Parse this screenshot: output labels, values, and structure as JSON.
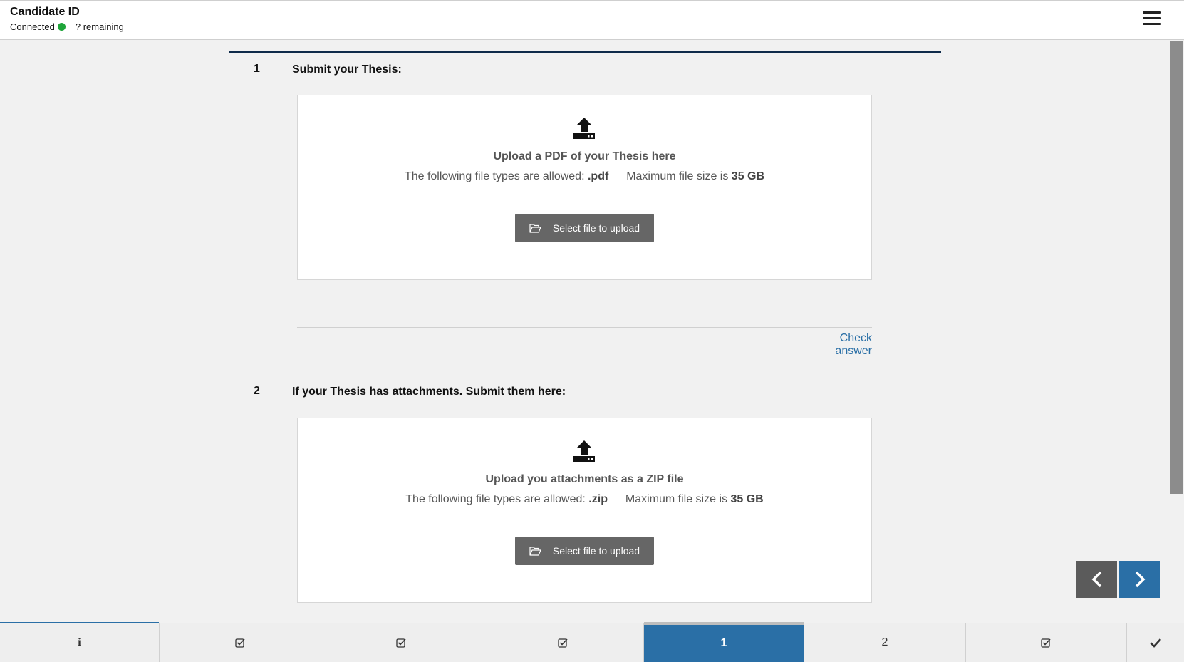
{
  "header": {
    "title": "Candidate ID",
    "status_label": "Connected",
    "status_color": "#1fa53a",
    "remaining": "? remaining",
    "menu_icon": "hamburger-menu-icon"
  },
  "questions": [
    {
      "number": "1",
      "title": "Submit your Thesis:",
      "upload_title": "Upload a PDF of your Thesis here",
      "allowed_label": "The following file types are allowed:",
      "allowed_types": ".pdf",
      "max_label": "Maximum file size is",
      "max_size": "35 GB",
      "button_label": "Select file to upload"
    },
    {
      "number": "2",
      "title": "If your Thesis has attachments. Submit them here:",
      "upload_title": "Upload you attachments as a ZIP file",
      "allowed_label": "The following file types are allowed:",
      "allowed_types": ".zip",
      "max_label": "Maximum file size is",
      "max_size": "35 GB",
      "button_label": "Select file to upload"
    }
  ],
  "check_answer": "Check answer",
  "navigation": {
    "prev_icon": "chevron-left-icon",
    "next_icon": "chevron-right-icon"
  },
  "bottom_tabs": [
    {
      "label": "i",
      "icon": "info-icon",
      "state": "visited"
    },
    {
      "label": "",
      "icon": "checkbox-checked-icon",
      "state": "answered"
    },
    {
      "label": "",
      "icon": "checkbox-checked-icon",
      "state": "answered"
    },
    {
      "label": "",
      "icon": "checkbox-checked-icon",
      "state": "answered"
    },
    {
      "label": "1",
      "icon": "",
      "state": "active"
    },
    {
      "label": "2",
      "icon": "",
      "state": "unanswered"
    },
    {
      "label": "",
      "icon": "checkbox-checked-icon",
      "state": "answered"
    },
    {
      "label": "",
      "icon": "checkmark-icon",
      "state": "finish"
    }
  ],
  "colors": {
    "accent": "#2a6fa6",
    "header_rule": "#0f2b4a",
    "button_gray": "#666666"
  }
}
